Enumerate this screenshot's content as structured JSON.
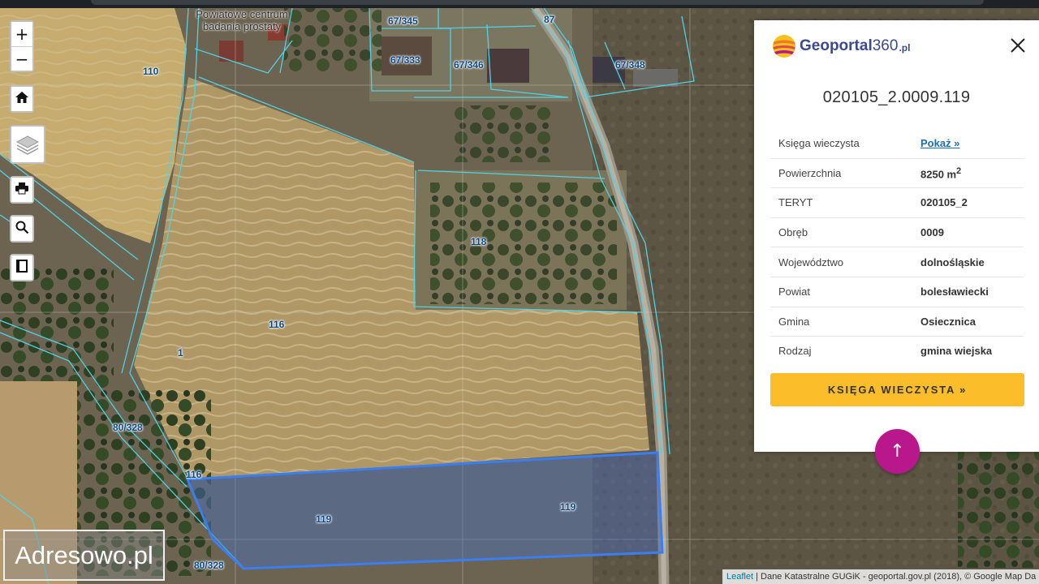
{
  "controls": {
    "zoom_in": "+",
    "zoom_out": "−",
    "home_icon": "home-icon",
    "layers_icon": "layers-icon",
    "print_icon": "print-icon",
    "search_icon": "search-icon",
    "book_icon": "book-icon"
  },
  "map": {
    "poi_label_line1": "Powiatowe centrum",
    "poi_label_line2": "badania prostaty",
    "parcel_labels": [
      "67/345",
      "87",
      "67/333",
      "67/346",
      "67/348",
      "110",
      "118",
      "116",
      "1",
      "80/328",
      "116",
      "119",
      "119",
      "80/328"
    ],
    "selected_parcel_color": "#3a7ef0"
  },
  "panel": {
    "logo_brand": "Geoportal",
    "logo_num": "360",
    "logo_tld": ".pl",
    "parcel_id": "020105_2.0009.119",
    "rows": [
      {
        "key": "Księga wieczysta",
        "value": "Pokaż »"
      },
      {
        "key": "Powierzchnia",
        "value": "8250 m",
        "sup": "2"
      },
      {
        "key": "TERYT",
        "value": "020105_2"
      },
      {
        "key": "Obręb",
        "value": "0009"
      },
      {
        "key": "Województwo",
        "value": "dolnośląskie"
      },
      {
        "key": "Powiat",
        "value": "bolesławiecki"
      },
      {
        "key": "Gmina",
        "value": "Osiecznica"
      },
      {
        "key": "Rodzaj",
        "value": "gmina wiejska"
      }
    ],
    "button_label": "KSIĘGA WIECZYSTA »",
    "accent_color": "#fbbd2a"
  },
  "scroll_up_label": "↑",
  "watermark": "Adresowo.pl",
  "attribution": {
    "leaflet": "Leaflet",
    "text": " | Dane Katastralne GUGiK - geoportal.gov.pl (2018), © Google Map Da"
  }
}
